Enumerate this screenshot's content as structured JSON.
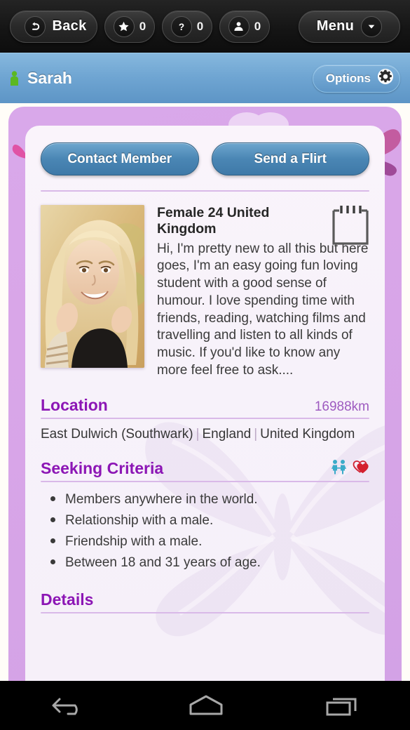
{
  "toolbar": {
    "back_label": "Back",
    "back_icon": "undo-arrow-icon",
    "badges": [
      {
        "icon": "star-icon",
        "count": "0"
      },
      {
        "icon": "question-mark-icon",
        "count": "0"
      },
      {
        "icon": "person-icon",
        "count": "0"
      }
    ],
    "menu_label": "Menu",
    "menu_icon": "chevron-down-icon"
  },
  "userbar": {
    "username": "Sarah",
    "user_icon": "person-online-icon",
    "options_label": "Options",
    "options_icon": "gear-icon"
  },
  "actions": {
    "contact_label": "Contact Member",
    "flirt_label": "Send a Flirt"
  },
  "profile": {
    "photo_alt": "member-photo",
    "headline": "Female 24 United Kingdom",
    "note_icon": "notepad-icon",
    "bio": "Hi, I'm pretty new to all this but here goes, I'm an easy going fun loving student with a good sense of humour. I love spending time with friends, reading, watching films and travelling and listen to all kinds of music. If you'd like to know any more feel free to ask...."
  },
  "location": {
    "title": "Location",
    "distance": "16988km",
    "city": "East Dulwich (Southwark)",
    "region": "England",
    "country": "United Kingdom",
    "separator": "|"
  },
  "seeking": {
    "title": "Seeking Criteria",
    "icons": [
      "couple-icon",
      "two-hearts-icon"
    ],
    "items": [
      "Members anywhere in the world.",
      "Relationship with a male.",
      "Friendship with a male.",
      "Between 18 and 31 years of age."
    ]
  },
  "details": {
    "title": "Details"
  },
  "navbar": {
    "back_icon": "android-back-icon",
    "home_icon": "android-home-icon",
    "recents_icon": "android-recents-icon"
  },
  "colors": {
    "accent_purple": "#8c16b5",
    "distance_purple": "#9e5bc0",
    "button_blue": "#4a86b4",
    "header_blue": "#6fa5d2",
    "panel_purple": "#d9a6e8",
    "heart_red": "#d4202e",
    "couple_teal": "#3aabc9",
    "online_green": "#5cb821"
  }
}
